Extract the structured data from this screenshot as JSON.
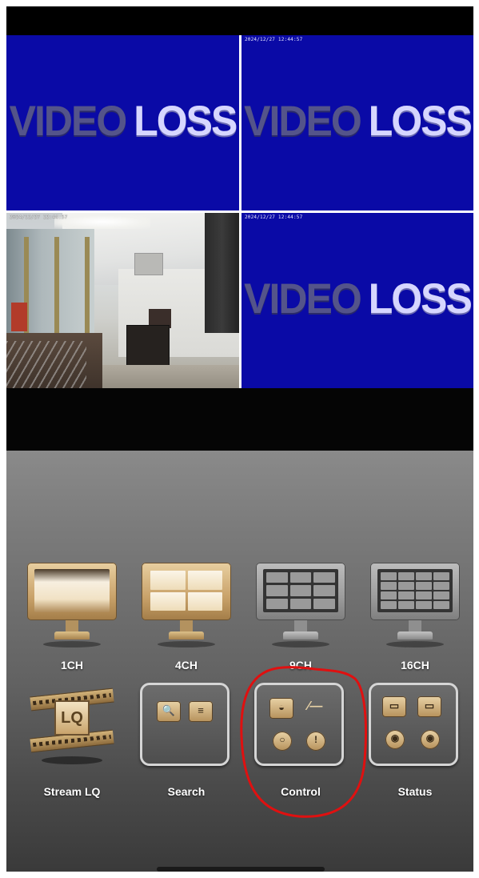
{
  "channels": [
    {
      "id": "ch1",
      "timestamp": "",
      "status_text": ""
    },
    {
      "id": "ch2",
      "timestamp": "2024/12/27 12:44:57",
      "status_word1": "VIDEO",
      "status_word2": "LOSS"
    },
    {
      "id": "ch3",
      "timestamp": "2024/12/27 12:44:57",
      "status_text": ""
    },
    {
      "id": "ch4",
      "timestamp": "2024/12/27 12:44:57",
      "status_word1": "VIDEO",
      "status_word2": "LOSS"
    }
  ],
  "ch1": {
    "status_word1": "VIDEO",
    "status_word2": "LOSS"
  },
  "menu": {
    "row1": [
      {
        "label": "1CH",
        "icon": "single-monitor-icon",
        "selected": true
      },
      {
        "label": "4CH",
        "icon": "quad-monitor-icon",
        "selected": true
      },
      {
        "label": "9CH",
        "icon": "nine-grid-monitor-icon",
        "selected": false
      },
      {
        "label": "16CH",
        "icon": "sixteen-grid-monitor-icon",
        "selected": false
      }
    ],
    "row2": [
      {
        "label": "Stream LQ",
        "icon": "film-strip-lq-icon"
      },
      {
        "label": "Search",
        "icon": "search-records-icon"
      },
      {
        "label": "Control",
        "icon": "control-panel-icon"
      },
      {
        "label": "Status",
        "icon": "status-monitors-icon"
      }
    ]
  },
  "colors": {
    "video_loss_bg": "#0a0aa6",
    "gold_icon": "#c9a26a",
    "annotation_red": "#e01010"
  },
  "lq_text": "LQ"
}
